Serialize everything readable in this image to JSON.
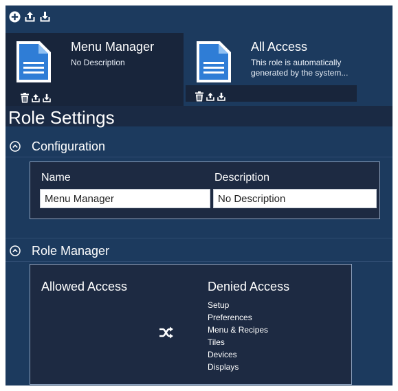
{
  "toolbar": {
    "icons": [
      "add-icon",
      "upload-icon",
      "download-icon"
    ]
  },
  "roles": [
    {
      "title": "Menu Manager",
      "description": "No Description",
      "selected": true,
      "icon": "document-icon"
    },
    {
      "title": "All Access",
      "description": "This role is automatically generated by the system...",
      "selected": false,
      "icon": "document-icon"
    }
  ],
  "page": {
    "title": "Role Settings"
  },
  "configuration": {
    "section_label": "Configuration",
    "name_label": "Name",
    "name_value": "Menu Manager",
    "description_label": "Description",
    "description_value": "No Description"
  },
  "role_manager": {
    "section_label": "Role Manager",
    "allowed_label": "Allowed Access",
    "denied_label": "Denied Access",
    "allowed_items": [],
    "denied_items": [
      "Setup",
      "Preferences",
      "Menu & Recipes",
      "Tiles",
      "Devices",
      "Displays"
    ]
  },
  "colors": {
    "background": "#1c3a5e",
    "dark_panel": "#18253b",
    "panel_border": "#8fa3bf",
    "document_blue": "#2f7dd6"
  }
}
